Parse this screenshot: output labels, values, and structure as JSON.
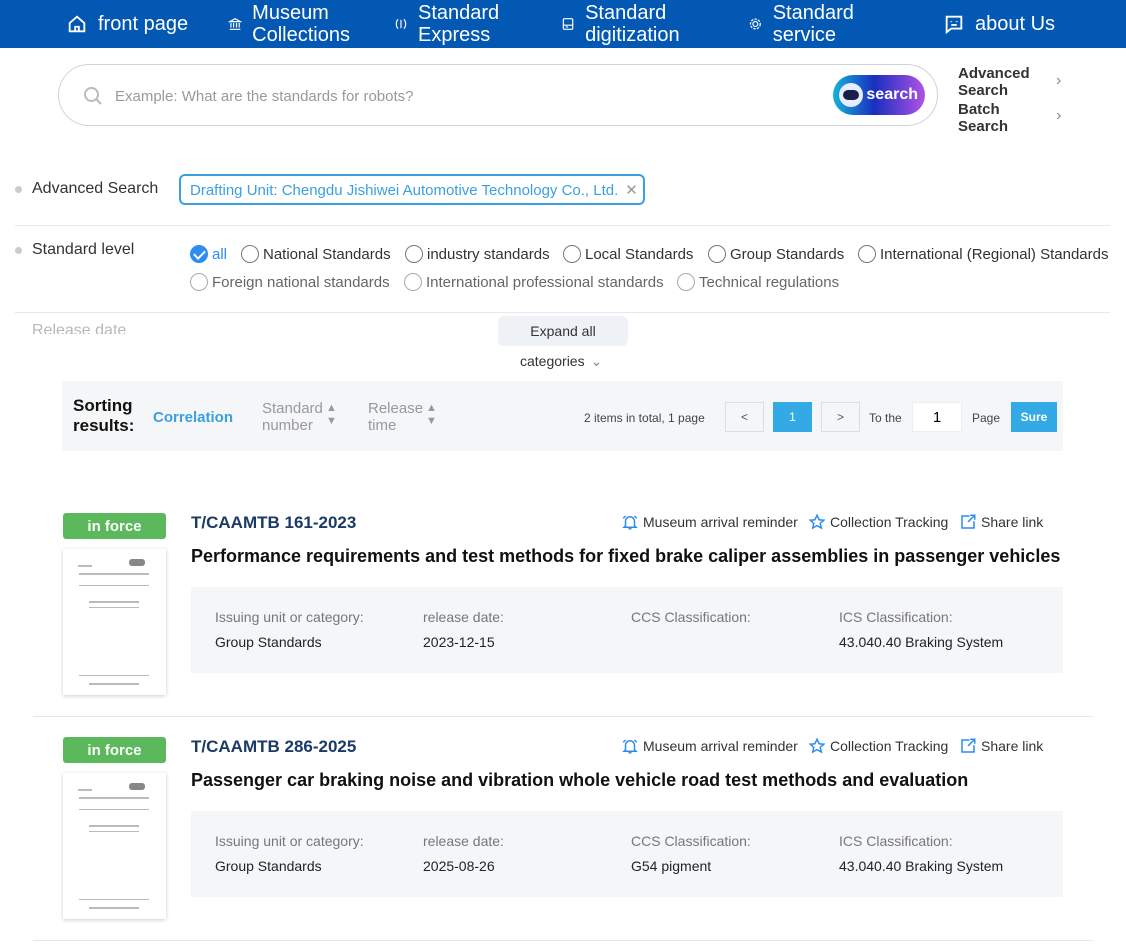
{
  "nav": {
    "items": [
      {
        "label": "front page",
        "icon": "home-icon"
      },
      {
        "label": "Museum Collections",
        "icon": "museum-icon"
      },
      {
        "label": "Standard Express",
        "icon": "express-icon"
      },
      {
        "label": "Standard digitization",
        "icon": "digitization-icon"
      },
      {
        "label": "Standard service",
        "icon": "service-icon"
      },
      {
        "label": "about Us",
        "icon": "chat-icon"
      }
    ]
  },
  "search": {
    "placeholder": "Example: What are the standards for robots?",
    "button": "search",
    "advanced": "Advanced Search",
    "batch": "Batch Search"
  },
  "filters": {
    "advanced_label": "Advanced Search",
    "advanced_tag": "Drafting Unit: Chengdu Jishiwei Automotive Technology Co., Ltd.",
    "level_label": "Standard level",
    "levels": [
      "all",
      "National Standards",
      "industry standards",
      "Local Standards",
      "Group Standards",
      "International (Regional) Standards",
      "Foreign national standards",
      "International professional standards",
      "Technical regulations"
    ],
    "selected_level": "all",
    "release_label": "Release date",
    "expand": "Expand all",
    "categories": "categories"
  },
  "sort": {
    "label": "Sorting results:",
    "options": [
      "Correlation",
      "Standard number",
      "Release time"
    ],
    "active": "Correlation",
    "total": "2 items in total, 1 page",
    "prev": "<",
    "page": "1",
    "next": ">",
    "to_the": "To the",
    "page_input": "1",
    "page_word": "Page",
    "sure": "Sure"
  },
  "actions": {
    "remind": "Museum arrival reminder",
    "track": "Collection Tracking",
    "share": "Share link"
  },
  "labels": {
    "issuing": "Issuing unit or category:",
    "release": "release date:",
    "ccs": "CCS Classification:",
    "ics": "ICS Classification:"
  },
  "results": [
    {
      "status": "in force",
      "code": "T/CAAMTB 161-2023",
      "title": "Performance requirements and test methods for fixed brake caliper assemblies in passenger vehicles",
      "issuing": "Group Standards",
      "release": "2023-12-15",
      "ccs": "",
      "ics": "43.040.40 Braking System"
    },
    {
      "status": "in force",
      "code": "T/CAAMTB 286-2025",
      "title": "Passenger car braking noise and vibration whole vehicle road test methods and evaluation",
      "issuing": "Group Standards",
      "release": "2025-08-26",
      "ccs": "G54 pigment",
      "ics": "43.040.40 Braking System"
    }
  ],
  "colors": {
    "nav": "#0358b3",
    "accent": "#2d8cf0",
    "badge": "#5cb85c",
    "code": "#1b3a66"
  }
}
